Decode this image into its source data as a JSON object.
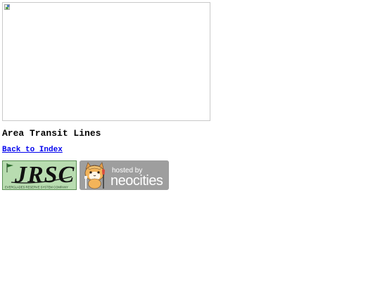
{
  "page": {
    "title": "Area Transit Lines",
    "back_link_label": "Back to Index"
  },
  "badges": {
    "jrsc": {
      "logo_text": "JRSC",
      "subtitle": "EVERGLADES RESERVE SYSTEM COMPANY"
    },
    "neocities": {
      "line1": "hosted by",
      "line2": "neocities"
    }
  },
  "icons": {
    "map_image": "broken-image-icon",
    "neocities_mascot": "cat-mascot-icon",
    "jrsc_flag": "flag-icon"
  },
  "colors": {
    "link": "#0000ee",
    "jrsc_bg": "#b8dcb0",
    "neocities_bg": "#9e9e9e"
  }
}
